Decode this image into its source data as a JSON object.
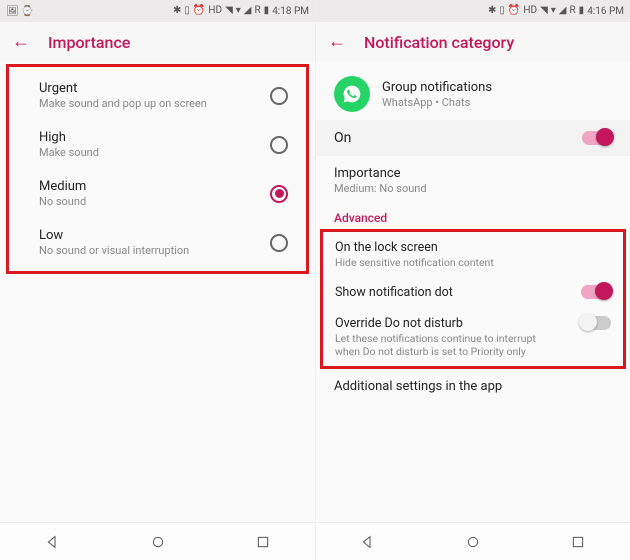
{
  "left": {
    "status_time": "4:18 PM",
    "status_net": "R",
    "status_hd": "HD",
    "title": "Importance",
    "options": [
      {
        "label": "Urgent",
        "desc": "Make sound and pop up on screen",
        "selected": false
      },
      {
        "label": "High",
        "desc": "Make sound",
        "selected": false
      },
      {
        "label": "Medium",
        "desc": "No sound",
        "selected": true
      },
      {
        "label": "Low",
        "desc": "No sound or visual interruption",
        "selected": false
      }
    ]
  },
  "right": {
    "status_time": "4:16 PM",
    "status_net": "R",
    "status_hd": "HD",
    "title": "Notification category",
    "app_name": "Group notifications",
    "app_sub": "WhatsApp • Chats",
    "enable_label": "On",
    "enable_on": true,
    "importance_label": "Importance",
    "importance_value": "Medium: No sound",
    "advanced_label": "Advanced",
    "adv": [
      {
        "label": "On the lock screen",
        "desc": "Hide sensitive notification content",
        "toggle": null
      },
      {
        "label": "Show notification dot",
        "desc": "",
        "toggle": true
      },
      {
        "label": "Override Do not disturb",
        "desc": "Let these notifications continue to interrupt when Do not disturb is set to Priority only",
        "toggle": false
      }
    ],
    "additional_label": "Additional settings in the app"
  }
}
